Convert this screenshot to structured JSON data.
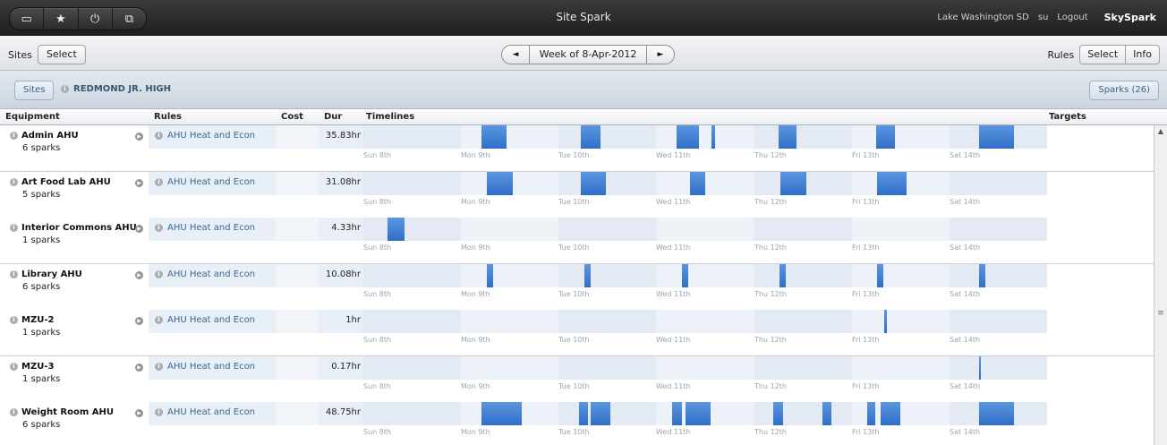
{
  "app": {
    "title": "Site Spark",
    "tools": [
      "▭",
      "★",
      "⏻",
      "⧉"
    ],
    "org": "Lake Washington SD",
    "user": "su",
    "logout": "Logout",
    "brand": "SkySpark"
  },
  "toolbar": {
    "sites_label": "Sites",
    "sites_select": "Select",
    "week": "Week of 8-Apr-2012",
    "prev": "◄",
    "next": "►",
    "rules_label": "Rules",
    "rules_select": "Select",
    "rules_info": "Info"
  },
  "crumb": {
    "sites": "Sites",
    "site": "REDMOND JR. HIGH",
    "sparks": "Sparks (26)"
  },
  "columns": {
    "equipment": "Equipment",
    "rules": "Rules",
    "cost": "Cost",
    "dur": "Dur",
    "timelines": "Timelines",
    "targets": "Targets"
  },
  "days": [
    "Sun 8th",
    "Mon 9th",
    "Tue 10th",
    "Wed 11th",
    "Thu 12th",
    "Fri 13th",
    "Sat 14th"
  ],
  "rows": [
    {
      "name": "Admin AHU",
      "sparks": "6 sparks",
      "rule": "AHU Heat and Econ",
      "cost": "",
      "dur": "35.83hr",
      "spans": [
        [
          1.21,
          1.47
        ],
        [
          2.23,
          2.43
        ],
        [
          3.21,
          3.44
        ],
        [
          3.56,
          3.6
        ],
        [
          4.25,
          4.43
        ],
        [
          5.25,
          5.44
        ],
        [
          6.3,
          6.66
        ]
      ]
    },
    {
      "name": "Art Food Lab AHU",
      "sparks": "5 sparks",
      "rule": "AHU Heat and Econ",
      "cost": "",
      "dur": "31.08hr",
      "spans": [
        [
          1.26,
          1.53
        ],
        [
          2.23,
          2.49
        ],
        [
          3.34,
          3.5
        ],
        [
          4.27,
          4.54
        ],
        [
          5.26,
          5.56
        ]
      ]
    },
    {
      "name": "Interior Commons AHU",
      "sparks": "1 sparks",
      "rule": "AHU Heat and Econ",
      "cost": "",
      "dur": "4.33hr",
      "spans": [
        [
          0.25,
          0.42
        ]
      ]
    },
    {
      "name": "Library AHU",
      "sparks": "6 sparks",
      "rule": "AHU Heat and Econ",
      "cost": "",
      "dur": "10.08hr",
      "spans": [
        [
          1.26,
          1.32
        ],
        [
          2.26,
          2.32
        ],
        [
          3.26,
          3.32
        ],
        [
          4.26,
          4.32
        ],
        [
          5.26,
          5.32
        ],
        [
          6.3,
          6.36
        ]
      ]
    },
    {
      "name": "MZU-2",
      "sparks": "1 sparks",
      "rule": "AHU Heat and Econ",
      "cost": "",
      "dur": "1hr",
      "spans": [
        [
          5.33,
          5.36
        ]
      ]
    },
    {
      "name": "MZU-3",
      "sparks": "1 sparks",
      "rule": "AHU Heat and Econ",
      "cost": "",
      "dur": "0.17hr",
      "spans": [
        [
          6.3,
          6.31
        ]
      ]
    },
    {
      "name": "Weight Room AHU",
      "sparks": "6 sparks",
      "rule": "AHU Heat and Econ",
      "cost": "",
      "dur": "48.75hr",
      "spans": [
        [
          1.21,
          1.32
        ],
        [
          1.32,
          1.53
        ],
        [
          1.53,
          1.62
        ],
        [
          2.21,
          2.3
        ],
        [
          2.33,
          2.53
        ],
        [
          3.16,
          3.26
        ],
        [
          3.3,
          3.56
        ],
        [
          4.2,
          4.3
        ],
        [
          4.7,
          4.79
        ],
        [
          5.16,
          5.24
        ],
        [
          5.3,
          5.5
        ],
        [
          6.3,
          6.66
        ]
      ]
    }
  ],
  "colors": {
    "spark": "#2f6fc8",
    "timeline_bg": "#edf2f8"
  }
}
